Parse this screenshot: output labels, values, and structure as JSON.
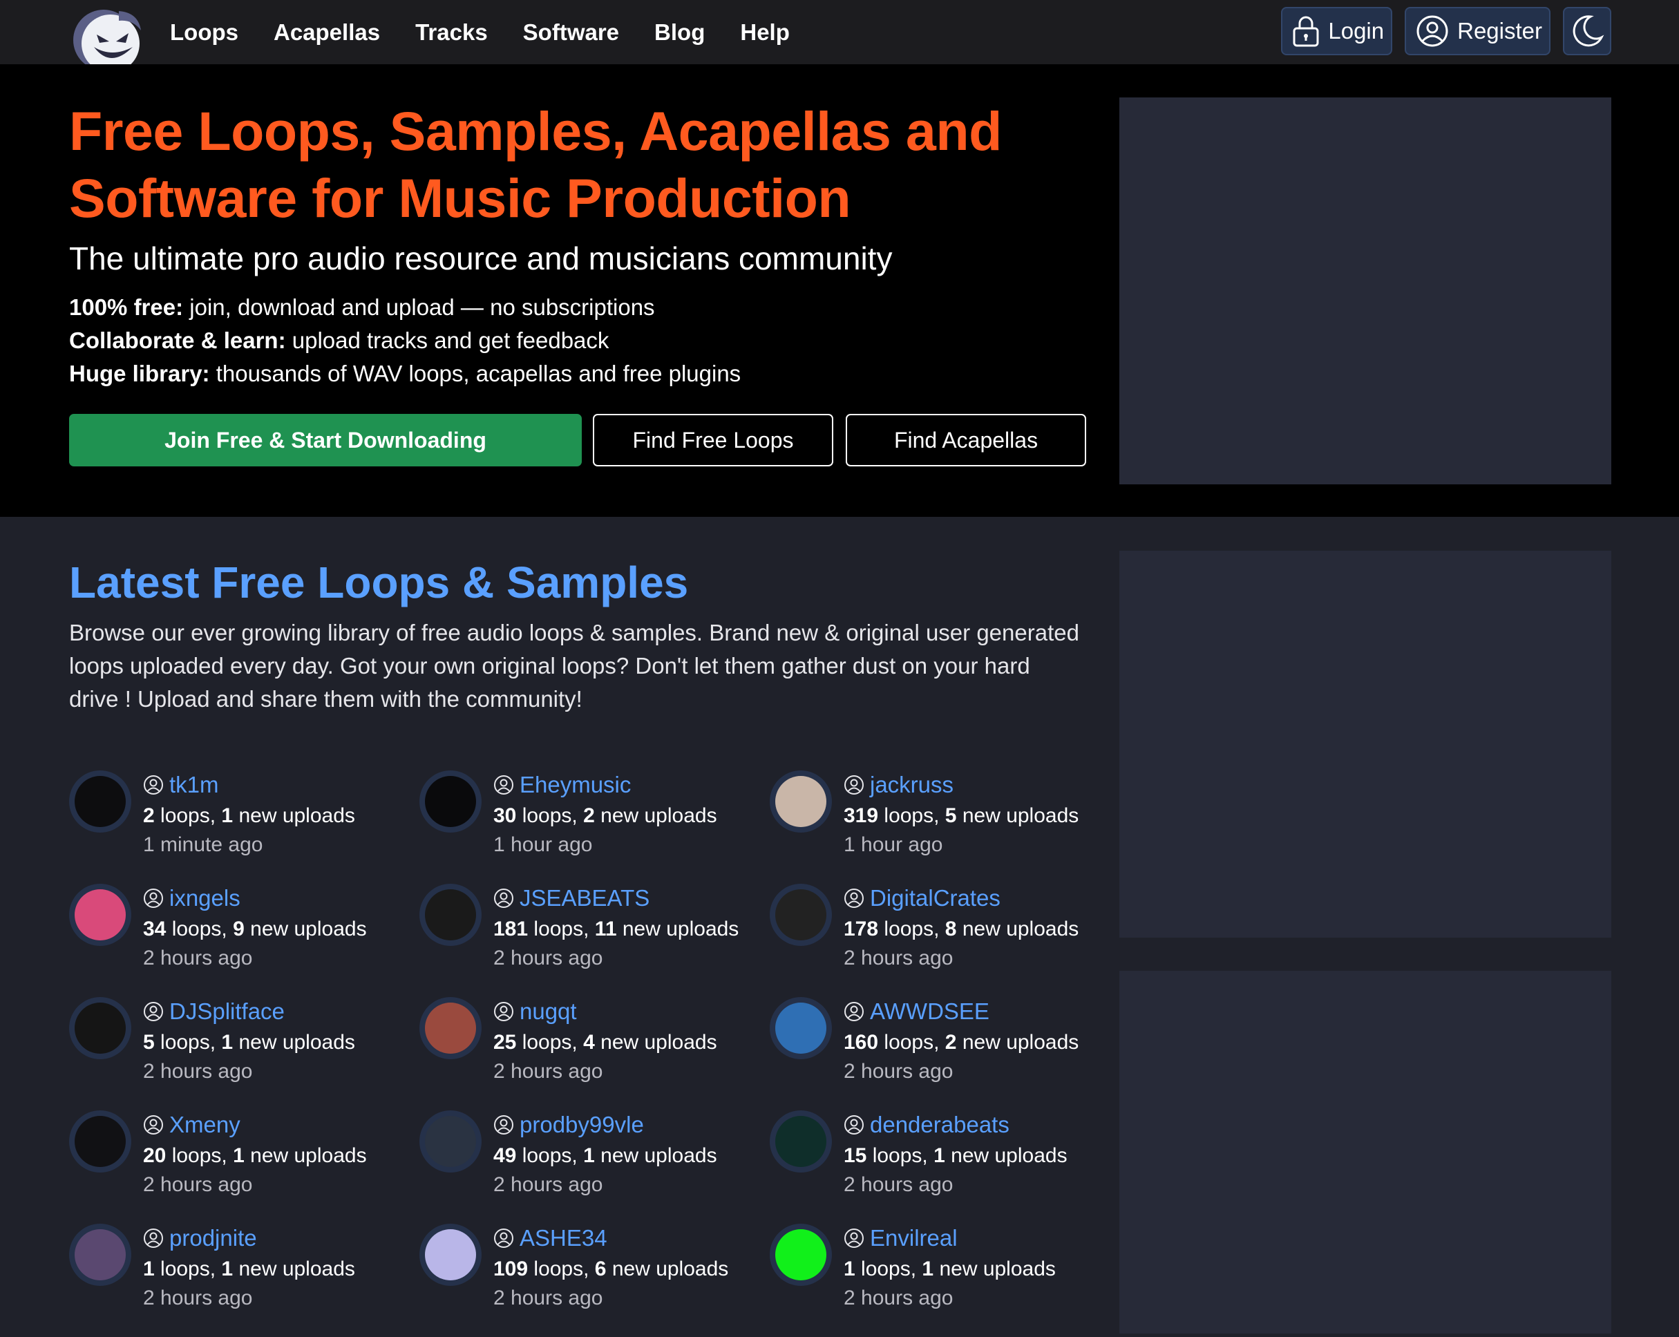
{
  "nav": {
    "links": [
      "Loops",
      "Acapellas",
      "Tracks",
      "Software",
      "Blog",
      "Help"
    ],
    "login": "Login",
    "register": "Register"
  },
  "hero": {
    "title": "Free Loops, Samples, Acapellas and Software for Music Production",
    "subtitle": "The ultimate pro audio resource and musicians community",
    "features": [
      {
        "label": "100% free:",
        "text": " join, download and upload — no subscriptions"
      },
      {
        "label": "Collaborate & learn:",
        "text": " upload tracks and get feedback"
      },
      {
        "label": "Huge library:",
        "text": " thousands of WAV loops, acapellas and free plugins"
      }
    ],
    "join_button": "Join Free & Start Downloading",
    "loops_button": "Find Free Loops",
    "acapellas_button": "Find Acapellas"
  },
  "latest": {
    "title": "Latest Free Loops & Samples",
    "description": "Browse our ever growing library of free audio loops & samples. Brand new & original user generated loops uploaded every day. Got your own original loops? Don't let them gather dust on your hard drive ! Upload and share them with the community!",
    "loops_word": " loops, ",
    "uploads_word": " new uploads",
    "users": [
      {
        "name": "tk1m",
        "loops": "2",
        "uploads": "1",
        "time": "1 minute ago",
        "color": "#0d0d0f"
      },
      {
        "name": "Eheymusic",
        "loops": "30",
        "uploads": "2",
        "time": "1 hour ago",
        "color": "#0a0a0c"
      },
      {
        "name": "jackruss",
        "loops": "319",
        "uploads": "5",
        "time": "1 hour ago",
        "color": "#c9b6a8"
      },
      {
        "name": "ixngels",
        "loops": "34",
        "uploads": "9",
        "time": "2 hours ago",
        "color": "#d94a7a"
      },
      {
        "name": "JSEABEATS",
        "loops": "181",
        "uploads": "11",
        "time": "2 hours ago",
        "color": "#1a1a1a"
      },
      {
        "name": "DigitalCrates",
        "loops": "178",
        "uploads": "8",
        "time": "2 hours ago",
        "color": "#222"
      },
      {
        "name": "DJSplitface",
        "loops": "5",
        "uploads": "1",
        "time": "2 hours ago",
        "color": "#151515"
      },
      {
        "name": "nugqt",
        "loops": "25",
        "uploads": "4",
        "time": "2 hours ago",
        "color": "#9a4a3e"
      },
      {
        "name": "AWWDSEE",
        "loops": "160",
        "uploads": "2",
        "time": "2 hours ago",
        "color": "#2f6fb4"
      },
      {
        "name": "Xmeny",
        "loops": "20",
        "uploads": "1",
        "time": "2 hours ago",
        "color": "#111114"
      },
      {
        "name": "prodby99vle",
        "loops": "49",
        "uploads": "1",
        "time": "2 hours ago",
        "color": "#2a3342"
      },
      {
        "name": "denderabeats",
        "loops": "15",
        "uploads": "1",
        "time": "2 hours ago",
        "color": "#0f2e2a"
      },
      {
        "name": "prodjnite",
        "loops": "1",
        "uploads": "1",
        "time": "2 hours ago",
        "color": "#5a4870"
      },
      {
        "name": "ASHE34",
        "loops": "109",
        "uploads": "6",
        "time": "2 hours ago",
        "color": "#b9b6e8"
      },
      {
        "name": "Envilreal",
        "loops": "1",
        "uploads": "1",
        "time": "2 hours ago",
        "color": "#11f01a"
      }
    ]
  },
  "colors": {
    "accent_orange": "#ff5a1f",
    "link_blue": "#5aa0ff",
    "join_green": "#1f9251"
  },
  "icons": [
    "logo-mascot-icon",
    "lock-icon",
    "user-circle-icon",
    "moon-icon"
  ]
}
